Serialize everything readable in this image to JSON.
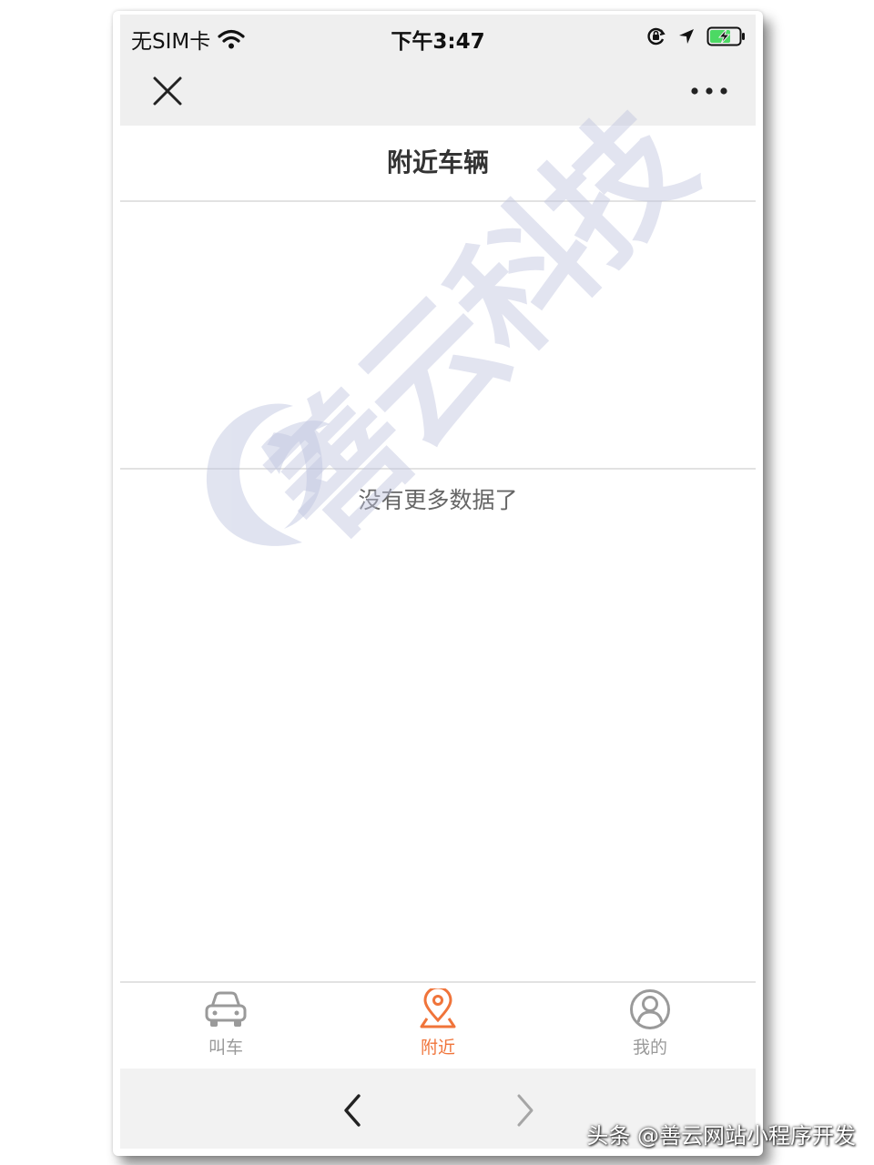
{
  "status_bar": {
    "carrier": "无SIM卡",
    "time": "下午3:47",
    "icons": [
      "wifi-icon",
      "orientation-lock-icon",
      "location-arrow-icon",
      "battery-charging-icon"
    ]
  },
  "nav": {
    "close_icon": "close-icon",
    "more_icon": "more-dots-icon"
  },
  "page": {
    "title": "附近车辆",
    "empty_message": "没有更多数据了"
  },
  "watermark": {
    "text": "善云科技"
  },
  "tabs": [
    {
      "label": "叫车",
      "icon": "car-icon",
      "active": false
    },
    {
      "label": "附近",
      "icon": "location-pin-icon",
      "active": true
    },
    {
      "label": "我的",
      "icon": "user-icon",
      "active": false
    }
  ],
  "browser_bar": {
    "back_icon": "chevron-left-icon",
    "forward_icon": "chevron-right-icon"
  },
  "credit": "头条 @善云网站小程序开发",
  "colors": {
    "accent": "#f0743a",
    "inactive": "#9a9a9a",
    "bar_bg": "#efefef",
    "battery": "#4cd964"
  }
}
